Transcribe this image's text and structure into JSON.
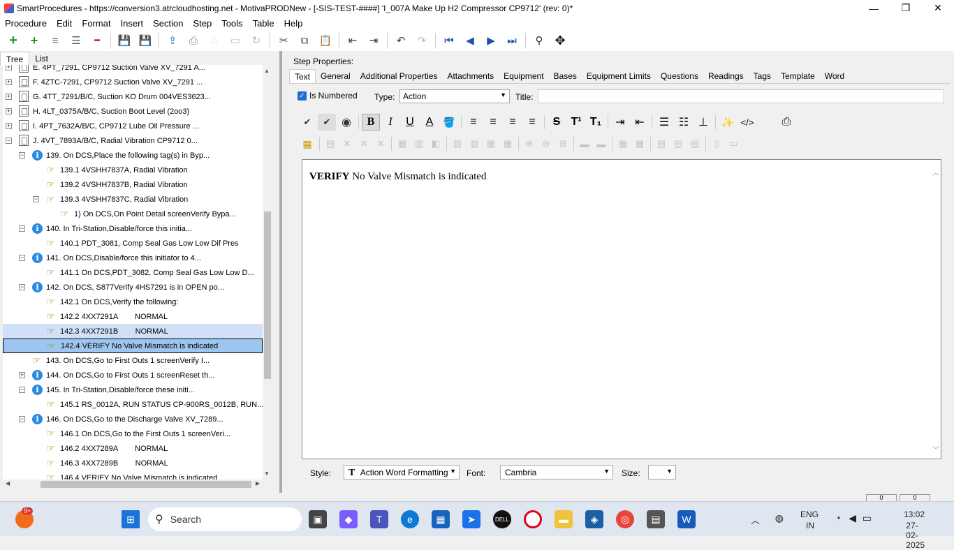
{
  "window": {
    "title": "SmartProcedures - https://conversion3.atrcloudhosting.net - MotivaPRODNew - [-SIS-TEST-####] 'I_007A Make Up H2 Compressor CP9712' (rev: 0)*",
    "minimize": "—",
    "maximize": "❐",
    "close": "✕"
  },
  "menu": [
    {
      "label": "Procedure"
    },
    {
      "label": "Edit"
    },
    {
      "label": "Format"
    },
    {
      "label": "Insert"
    },
    {
      "label": "Section"
    },
    {
      "label": "Step"
    },
    {
      "label": "Tools"
    },
    {
      "label": "Table"
    },
    {
      "label": "Help"
    }
  ],
  "toolbar_icons": {
    "add": "+",
    "add_sub": "+",
    "indent_list": "≡",
    "outline": "☰",
    "remove": "━",
    "save_all": "💾",
    "save": "💾",
    "publish": "⇪",
    "print": "⎙",
    "refresh": "◌",
    "preview": "▭",
    "redo_cycle": "↻",
    "cut": "✂",
    "copy": "⧉",
    "paste": "📋",
    "outdent": "⇤",
    "indent": "⇥",
    "undo": "↶",
    "redo": "↷",
    "first": "⏮",
    "prev": "◀",
    "next": "▶",
    "last": "⏭",
    "find": "⚲",
    "move": "✥"
  },
  "left_tabs": [
    {
      "label": "Tree"
    },
    {
      "label": "List"
    }
  ],
  "tree": [
    {
      "text": "E. 4PT_7291, CP9712 Suction Valve XV_7291 A...",
      "icon": "doc",
      "expander": "+",
      "level": 0,
      "state": ""
    },
    {
      "text": "F. 4ZTC-7291, CP9712 Suction Valve XV_7291 ...",
      "icon": "doc",
      "expander": "+",
      "level": 0,
      "state": ""
    },
    {
      "text": "G. 4TT_7291/B/C, Suction KO Drum 004VES3623...",
      "icon": "doc",
      "expander": "+",
      "level": 0,
      "state": ""
    },
    {
      "text": "H. 4LT_0375A/B/C, Suction Boot Level (2oo3)",
      "icon": "doc",
      "expander": "+",
      "level": 0,
      "state": ""
    },
    {
      "text": "I. 4PT_7632A/B/C, CP9712 Lube Oil Pressure ...",
      "icon": "doc",
      "expander": "+",
      "level": 0,
      "state": ""
    },
    {
      "text": "J. 4VT_7893A/B/C, Radial Vibration CP9712 0...",
      "icon": "doc",
      "expander": "−",
      "level": 0,
      "state": ""
    },
    {
      "text": "139. On DCS,Place the following tag(s) in Byp...",
      "icon": "info",
      "expander": "−",
      "level": 1,
      "state": ""
    },
    {
      "text": "139.1 4VSHH7837A, Radial Vibration",
      "icon": "hand",
      "expander": "",
      "level": 2,
      "state": ""
    },
    {
      "text": "139.2 4VSHH7837B, Radial Vibration",
      "icon": "hand",
      "expander": "",
      "level": 2,
      "state": ""
    },
    {
      "text": "139.3 4VSHH7837C, Radial Vibration",
      "icon": "hand",
      "expander": "−",
      "level": 2,
      "state": ""
    },
    {
      "text": "1) On DCS,On Point Detail screenVerify Bypa...",
      "icon": "hand",
      "expander": "",
      "level": 3,
      "state": ""
    },
    {
      "text": "140. In Tri-Station,Disable/force this initia...",
      "icon": "info",
      "expander": "−",
      "level": 1,
      "state": ""
    },
    {
      "text": "140.1 PDT_3081, Comp Seal Gas Low Low Dif Pres",
      "icon": "hand",
      "expander": "",
      "level": 2,
      "state": ""
    },
    {
      "text": "141. On DCS,Disable/force this initiator to 4...",
      "icon": "info",
      "expander": "−",
      "level": 1,
      "state": ""
    },
    {
      "text": "141.1 On DCS,PDT_3082, Comp Seal Gas Low Low D...",
      "icon": "hand",
      "expander": "",
      "level": 2,
      "state": ""
    },
    {
      "text": "142. On DCS, S877Verify 4HS7291 is in OPEN po...",
      "icon": "info",
      "expander": "−",
      "level": 1,
      "state": ""
    },
    {
      "text": "142.1 On DCS,Verify the following:",
      "icon": "hand",
      "expander": "",
      "level": 2,
      "state": ""
    },
    {
      "text": "142.2 4XX7291A        NORMAL",
      "icon": "hand",
      "expander": "",
      "level": 2,
      "state": ""
    },
    {
      "text": "142.3 4XX7291B        NORMAL",
      "icon": "hand",
      "expander": "",
      "level": 2,
      "state": "sel1"
    },
    {
      "text": "142.4 VERIFY No Valve Mismatch is indicated",
      "icon": "hand",
      "expander": "",
      "level": 2,
      "state": "sel2"
    },
    {
      "text": "143. On DCS,Go to First Outs 1 screenVerify I...",
      "icon": "hand",
      "expander": "",
      "level": 1,
      "state": ""
    },
    {
      "text": "144. On DCS,Go to First Outs 1 screenReset th...",
      "icon": "info",
      "expander": "+",
      "level": 1,
      "state": ""
    },
    {
      "text": "145. In Tri-Station,Disable/force these initi...",
      "icon": "info",
      "expander": "−",
      "level": 1,
      "state": ""
    },
    {
      "text": "145.1 RS_0012A, RUN STATUS CP-900RS_0012B, RUN...",
      "icon": "hand",
      "expander": "",
      "level": 2,
      "state": ""
    },
    {
      "text": "146. On DCS,Go to the Discharge Valve XV_7289...",
      "icon": "info",
      "expander": "−",
      "level": 1,
      "state": ""
    },
    {
      "text": "146.1 On DCS,Go to the First Outs 1 screenVeri...",
      "icon": "hand",
      "expander": "",
      "level": 2,
      "state": ""
    },
    {
      "text": "146.2 4XX7289A        NORMAL",
      "icon": "hand",
      "expander": "",
      "level": 2,
      "state": ""
    },
    {
      "text": "146.3 4XX7289B        NORMAL",
      "icon": "hand",
      "expander": "",
      "level": 2,
      "state": ""
    },
    {
      "text": "146.4 VERIFY No Valve Mismatch is indicated",
      "icon": "hand",
      "expander": "",
      "level": 2,
      "state": ""
    }
  ],
  "step_properties": {
    "heading": "Step Properties:",
    "tabs": [
      {
        "label": "Text",
        "active": true
      },
      {
        "label": "General"
      },
      {
        "label": "Additional Properties"
      },
      {
        "label": "Attachments"
      },
      {
        "label": "Equipment"
      },
      {
        "label": "Bases"
      },
      {
        "label": "Equipment Limits"
      },
      {
        "label": "Questions"
      },
      {
        "label": "Readings"
      },
      {
        "label": "Tags"
      },
      {
        "label": "Template"
      },
      {
        "label": "Word"
      }
    ],
    "is_numbered_label": "Is Numbered",
    "is_numbered_checked": true,
    "type_label": "Type:",
    "type_value": "Action",
    "title_label": "Title:",
    "title_value": "",
    "editor_bold": "VERIFY",
    "editor_rest": " No Valve Mismatch is indicated",
    "style_label": "Style:",
    "style_value": "Action Word Formatting",
    "font_label": "Font:",
    "font_value": "Cambria",
    "size_label": "Size:",
    "size_value": ""
  },
  "format_icons_row1": [
    "✔",
    "✔",
    "◉",
    "B",
    "I",
    "U",
    "A",
    "🪣",
    "≡",
    "≡",
    "≡",
    "≡",
    "S",
    "T¹",
    "T₁",
    "⇥",
    "⇤",
    "☰",
    "☷",
    "⊥",
    "✨",
    "</>",
    "⎙"
  ],
  "taskbar": {
    "search_label": "Search",
    "notif_badge": "9+",
    "lang": "ENG",
    "region": "IN",
    "time": "13:02",
    "date": "27-02-2025"
  }
}
